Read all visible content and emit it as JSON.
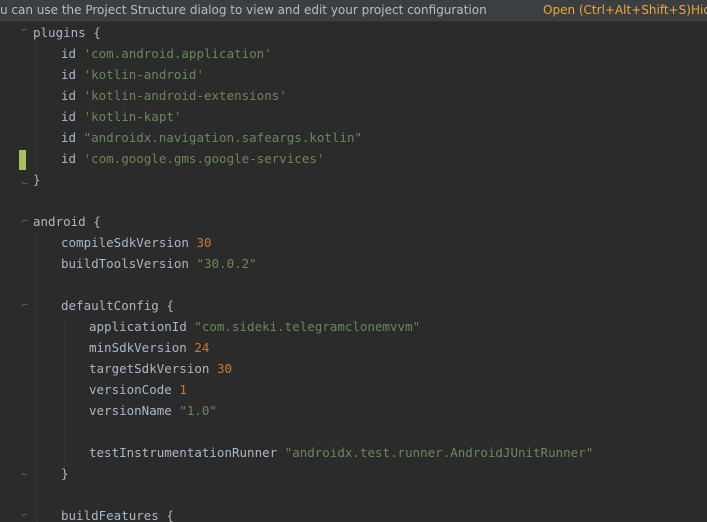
{
  "banner": {
    "message": "u can use the Project Structure dialog to view and edit your project configuration",
    "open_link": "Open (Ctrl+Alt+Shift+S)",
    "hide_link": "Hid"
  },
  "code": {
    "l1_kw": "plugins {",
    "l2_id": "id ",
    "l2_str": "'com.android.application'",
    "l3_id": "id ",
    "l3_str": "'kotlin-android'",
    "l4_id": "id ",
    "l4_str": "'kotlin-android-extensions'",
    "l5_id": "id ",
    "l5_str": "'kotlin-kapt'",
    "l6_id": "id ",
    "l6_str": "\"androidx.navigation.safeargs.kotlin\"",
    "l7_id": "id ",
    "l7_str": "'com.google.gms.google-services'",
    "l8": "}",
    "l10": "android {",
    "l11_key": "compileSdkVersion ",
    "l11_val": "30",
    "l12_key": "buildToolsVersion ",
    "l12_val": "\"30.0.2\"",
    "l14": "defaultConfig {",
    "l15_key": "applicationId ",
    "l15_val": "\"com.sideki.telegramclonemvvm\"",
    "l16_key": "minSdkVersion ",
    "l16_val": "24",
    "l17_key": "targetSdkVersion ",
    "l17_val": "30",
    "l18_key": "versionCode ",
    "l18_val": "1",
    "l19_key": "versionName ",
    "l19_val": "\"1.0\"",
    "l21_key": "testInstrumentationRunner ",
    "l21_val": "\"androidx.test.runner.AndroidJUnitRunner\"",
    "l22": "}",
    "l24": "buildFeatures {"
  },
  "colors": {
    "background": "#2b2b2b",
    "default_text": "#a9b7c6",
    "string": "#6a8759",
    "number": "#cc7832",
    "link": "#f0a732",
    "change_marker": "#a5c25c"
  }
}
